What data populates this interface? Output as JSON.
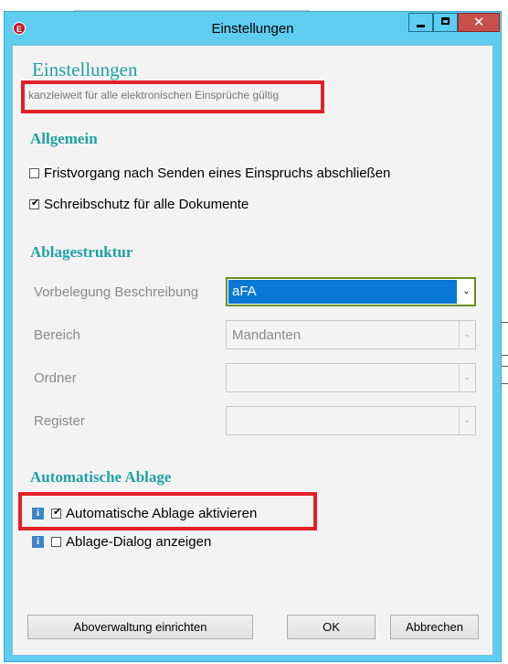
{
  "window": {
    "title": "Einstellungen",
    "app_icon_letter": "E",
    "close_glyph": "✕",
    "accent_color": "#5ecdef",
    "close_color": "#c7504a"
  },
  "header": {
    "title": "Einstellungen",
    "subtitle": "kanzleiweit für alle elektronischen Einsprüche gültig",
    "title_color": "#21a0a5"
  },
  "allgemein": {
    "heading": "Allgemein",
    "options": [
      {
        "label": "Fristvorgang nach Senden eines Einspruchs abschließen",
        "checked": false
      },
      {
        "label": "Schreibschutz für alle Dokumente",
        "checked": true
      }
    ]
  },
  "ablagestruktur": {
    "heading": "Ablagestruktur",
    "fields": [
      {
        "label": "Vorbelegung Beschreibung",
        "value": "aFA",
        "enabled": true
      },
      {
        "label": "Bereich",
        "value": "Mandanten",
        "enabled": false
      },
      {
        "label": "Ordner",
        "value": "",
        "enabled": false
      },
      {
        "label": "Register",
        "value": "",
        "enabled": false
      }
    ]
  },
  "automatische_ablage": {
    "heading": "Automatische Ablage",
    "options": [
      {
        "label": "Automatische Ablage aktivieren",
        "checked": true,
        "info_icon": "i"
      },
      {
        "label": "Ablage-Dialog anzeigen",
        "checked": false,
        "info_icon": "i"
      }
    ]
  },
  "buttons": {
    "aboverwaltung": "Aboverwaltung einrichten",
    "ok": "OK",
    "abbrechen": "Abbrechen"
  },
  "check_glyph": "✔",
  "dropdown_glyph": "⌄",
  "highlight_color": "#e2202a"
}
